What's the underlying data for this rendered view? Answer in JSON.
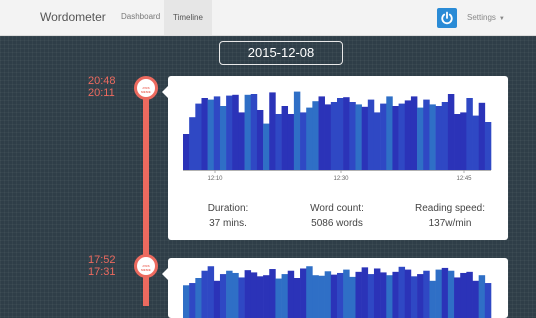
{
  "navbar": {
    "brand": "Wordometer",
    "links": [
      "Dashboard",
      "Timeline"
    ],
    "settings": "Settings",
    "colors": {
      "power": "#2a8bd6"
    }
  },
  "date": "2015-12-08",
  "colors": {
    "accent": "#ec6a5f",
    "bar_dark": "#2b33b8",
    "bar_mid": "#2f48c4",
    "bar_light": "#2f6fc6"
  },
  "entries": [
    {
      "start": "20:48",
      "end": "20:11",
      "node_label": "J!NS MEME",
      "stats": {
        "duration_label": "Duration:",
        "duration_value": "37 mins.",
        "words_label": "Word count:",
        "words_value": "5086 words",
        "speed_label": "Reading speed:",
        "speed_value": "137w/min"
      },
      "chart_data": {
        "type": "bar",
        "x_ticks": [
          "12:10",
          "12:30",
          "12:45"
        ],
        "ylim": [
          0,
          100
        ],
        "values": [
          45,
          66,
          83,
          90,
          88,
          92,
          80,
          93,
          94,
          72,
          94,
          95,
          75,
          58,
          97,
          70,
          80,
          70,
          98,
          72,
          78,
          86,
          92,
          82,
          85,
          90,
          91,
          85,
          82,
          79,
          88,
          72,
          83,
          92,
          80,
          83,
          87,
          92,
          78,
          88,
          82,
          80,
          85,
          95,
          70,
          72,
          90,
          68,
          84,
          60
        ]
      }
    },
    {
      "start": "17:52",
      "end": "17:31",
      "node_label": "J!NS MEME",
      "chart_data": {
        "type": "bar",
        "ylim": [
          0,
          100
        ],
        "values": [
          62,
          66,
          75,
          88,
          96,
          70,
          82,
          88,
          84,
          76,
          89,
          85,
          78,
          80,
          91,
          74,
          82,
          88,
          75,
          92,
          96,
          80,
          79,
          87,
          81,
          84,
          90,
          77,
          86,
          94,
          82,
          92,
          85,
          80,
          86,
          95,
          90,
          78,
          82,
          88,
          70,
          90,
          93,
          88,
          76,
          84,
          86,
          70,
          80,
          66
        ]
      }
    }
  ]
}
